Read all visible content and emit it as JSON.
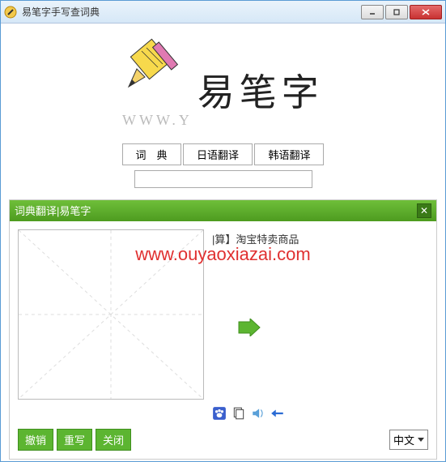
{
  "window": {
    "title": "易笔字手写查词典"
  },
  "logo": {
    "text": "易笔字",
    "sub": "WWW.Y"
  },
  "tabs": {
    "dict": "词　典",
    "jp": "日语翻译",
    "kr": "韩语翻译"
  },
  "search": {
    "value": ""
  },
  "panel": {
    "title": "词典翻译|易笔字",
    "result": "|算】淘宝特卖商品"
  },
  "watermark": "www.ouyaoxiazai.com",
  "actions": {
    "undo": "撤销",
    "rewrite": "重写",
    "close": "关闭"
  },
  "lang": {
    "selected": "中文"
  },
  "icons": {
    "paw": "paw-icon",
    "copy": "copy-icon",
    "sound": "sound-icon",
    "back": "back-icon"
  }
}
